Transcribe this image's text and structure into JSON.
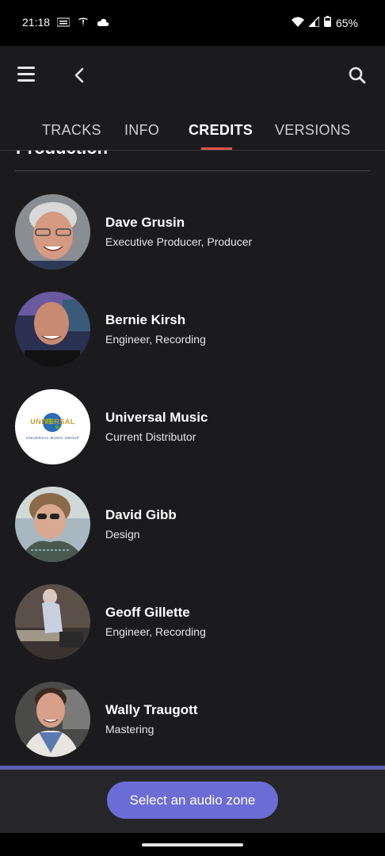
{
  "status_bar": {
    "time": "21:18",
    "icons": [
      "weather-badge-icon",
      "tesla-icon",
      "cloud-icon"
    ],
    "battery": "65%"
  },
  "header": {
    "tabs": [
      {
        "label": "TRACKS",
        "active": false
      },
      {
        "label": "INFO",
        "active": false
      },
      {
        "label": "CREDITS",
        "active": true
      },
      {
        "label": "VERSIONS",
        "active": false
      }
    ]
  },
  "section": {
    "title": "Production"
  },
  "credits": [
    {
      "name": "Dave Grusin",
      "role": "Executive Producer, Producer"
    },
    {
      "name": "Bernie Kirsh",
      "role": "Engineer, Recording"
    },
    {
      "name": "Universal Music",
      "role": "Current Distributor",
      "logo_text": "UNIVERSAL",
      "logo_subtext": "UNIVERSAL MUSIC GROUP"
    },
    {
      "name": "David Gibb",
      "role": "Design"
    },
    {
      "name": "Geoff Gillette",
      "role": "Engineer, Recording"
    },
    {
      "name": "Wally Traugott",
      "role": "Mastering"
    }
  ],
  "bottom": {
    "button_label": "Select an audio zone"
  },
  "colors": {
    "accent_underline": "#e0544c",
    "button_bg": "#6c6cd6",
    "background": "#1b1b1d"
  }
}
